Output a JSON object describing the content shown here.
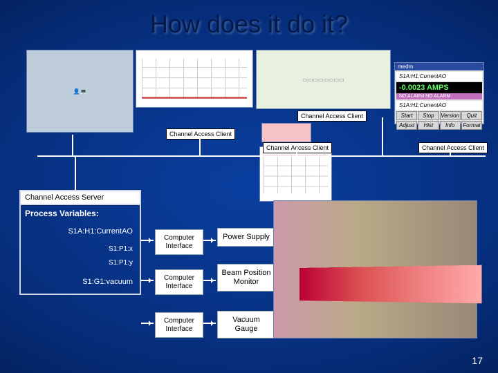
{
  "title": "How does it do it?",
  "client_label": "Channel Access Client",
  "server": {
    "title": "Channel Access Server",
    "subtitle": "Process Variables:",
    "pv1": "S1A:H1:CurrentAO",
    "pv2a": "S1:P1:x",
    "pv2b": "S1:P1:y",
    "pv3": "S1:G1:vacuum"
  },
  "interfaces": {
    "label": "Computer Interface",
    "dev1": "Power Supply",
    "dev2": "Beam Position Monitor",
    "dev3": "Vacuum Gauge"
  },
  "adjust_panel": {
    "window": "medm",
    "pv": "S1A:H1:CurrentAO",
    "value": "-0.0023 AMPS",
    "alarm": "NO ALARM   NO ALARM",
    "pv2": "S1A:H1:CurrentAO",
    "buttons": [
      "Start",
      "Stop",
      "Version",
      "Quit",
      "Adjust",
      "Hist",
      "Info",
      "Format"
    ]
  },
  "page_number": "17"
}
